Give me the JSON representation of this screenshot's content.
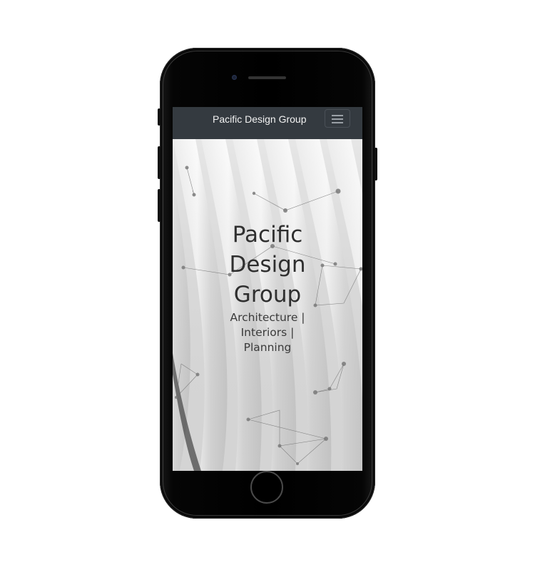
{
  "navbar": {
    "brand": "Pacific Design Group",
    "menu_icon": "hamburger-menu-icon"
  },
  "hero": {
    "title_lines": [
      "Pacific",
      "Design",
      "Group"
    ],
    "subtitle_lines": [
      "Architecture |",
      "Interiors |",
      "Planning"
    ]
  },
  "colors": {
    "navbar_bg": "#343a40",
    "brand_text": "#f2f2f2",
    "hero_text": "#2f2f2f"
  }
}
